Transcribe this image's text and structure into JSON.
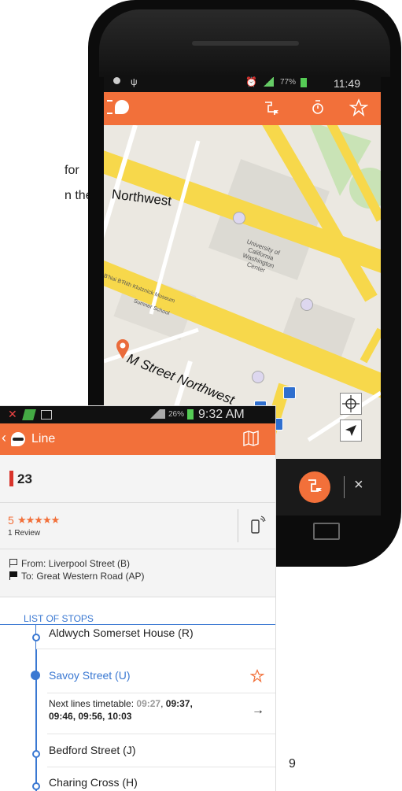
{
  "document": {
    "fragment_for": "for",
    "fragment_the": "n the",
    "page_number": "9"
  },
  "back_phone": {
    "status_time": "11:49",
    "battery": "77%",
    "map_labels": {
      "street_top": "Northwest",
      "street_main": "M Street Northwest",
      "museum": "B'Nai B'Rith Klutznick Museum",
      "school": "Sumner School",
      "center": "University of California Washington Center"
    }
  },
  "front_phone": {
    "status_time": "9:32 AM",
    "battery": "26%",
    "appbar": {
      "title": "Line",
      "back_icon": "chevron-left-icon",
      "map_icon": "map-icon"
    },
    "line": {
      "number": "23",
      "color": "#d9342b"
    },
    "rating": {
      "score": "5",
      "stars": "★★★★★",
      "reviews": "1 Review"
    },
    "route": {
      "from": "From: Liverpool Street (B)",
      "to": "To: Great Western Road  (AP)"
    },
    "list_header": "LIST OF STOPS",
    "stops": [
      {
        "name": "Aldwych  Somerset House (R)"
      },
      {
        "name": "Savoy Street (U)"
      },
      {
        "name": "Bedford Street (J)"
      },
      {
        "name": "Charing Cross (H)"
      }
    ],
    "timetable": {
      "label": "Next lines timetable: ",
      "past": "09:27",
      "sep": ", ",
      "line1_rest": "09:37,",
      "line2": "09:46, 09:56, 10:03"
    },
    "accent": "#f2703a",
    "link_color": "#3a78d2"
  }
}
